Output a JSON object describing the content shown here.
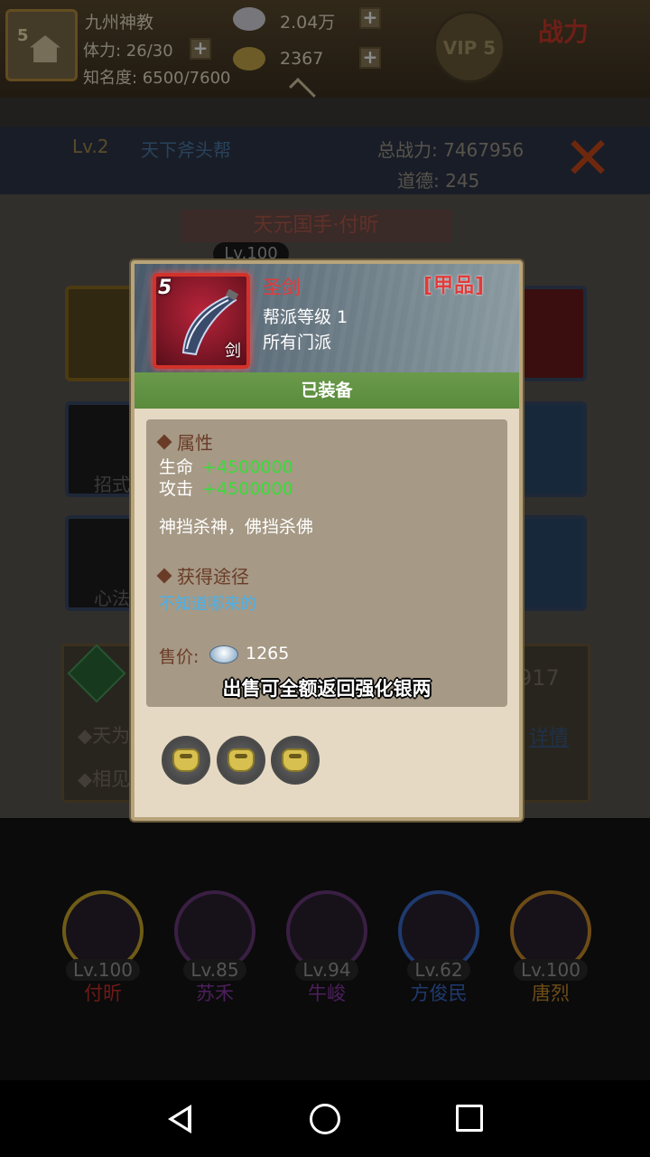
{
  "topbar": {
    "avatar_level": "5",
    "sect_name": "九州神教",
    "stamina": "体力: 26/30",
    "fame": "知名度: 6500/7600",
    "silver": "2.04万",
    "gold": "2367",
    "vip": "VIP 5",
    "power_logo": "战力"
  },
  "infobar": {
    "level": "Lv.2",
    "gang_name": "天下斧头帮",
    "total_power": "总战力: 7467956",
    "morality": "道德: 245"
  },
  "background": {
    "hero_title": "天元国手·付昕",
    "hero_level": "Lv.100",
    "slot_skill": "招式",
    "slot_mind": "心法",
    "right_number": "917",
    "detail_link": "详情",
    "bullet_1": "◆天为",
    "bullet_2": "◆相见"
  },
  "dialog": {
    "item_star": "5",
    "item_type": "剑",
    "item_name": "圣剑",
    "item_grade": "[甲品]",
    "requirement": "帮派等级 1",
    "school": "所有门派",
    "equipped_label": "已装备",
    "attr_title": "属性",
    "attributes": [
      {
        "name": "生命",
        "value": "+4500000"
      },
      {
        "name": "攻击",
        "value": "+4500000"
      }
    ],
    "flavor_text": "神挡杀神，佛挡杀佛",
    "source_title": "获得途径",
    "source_text": "不知道哪来的",
    "price_label": "售价:",
    "price_value": "1265",
    "sell_tip": "出售可全额返回强化银两",
    "gem_slots": 3
  },
  "team": [
    {
      "level": "Lv.100",
      "name": "付昕",
      "color": "#c8302a"
    },
    {
      "level": "Lv.85",
      "name": "苏禾",
      "color": "#8a3aa8"
    },
    {
      "level": "Lv.94",
      "name": "牛峻",
      "color": "#8a3aa8"
    },
    {
      "level": "Lv.62",
      "name": "方俊民",
      "color": "#3a6ac8"
    },
    {
      "level": "Lv.100",
      "name": "唐烈",
      "color": "#c88a2a"
    }
  ],
  "colors": {
    "item_name_red": "#e23a3a",
    "attr_green": "#3adb3a",
    "source_blue": "#4ab0e8",
    "equipped_green": "#5a8a3c"
  }
}
